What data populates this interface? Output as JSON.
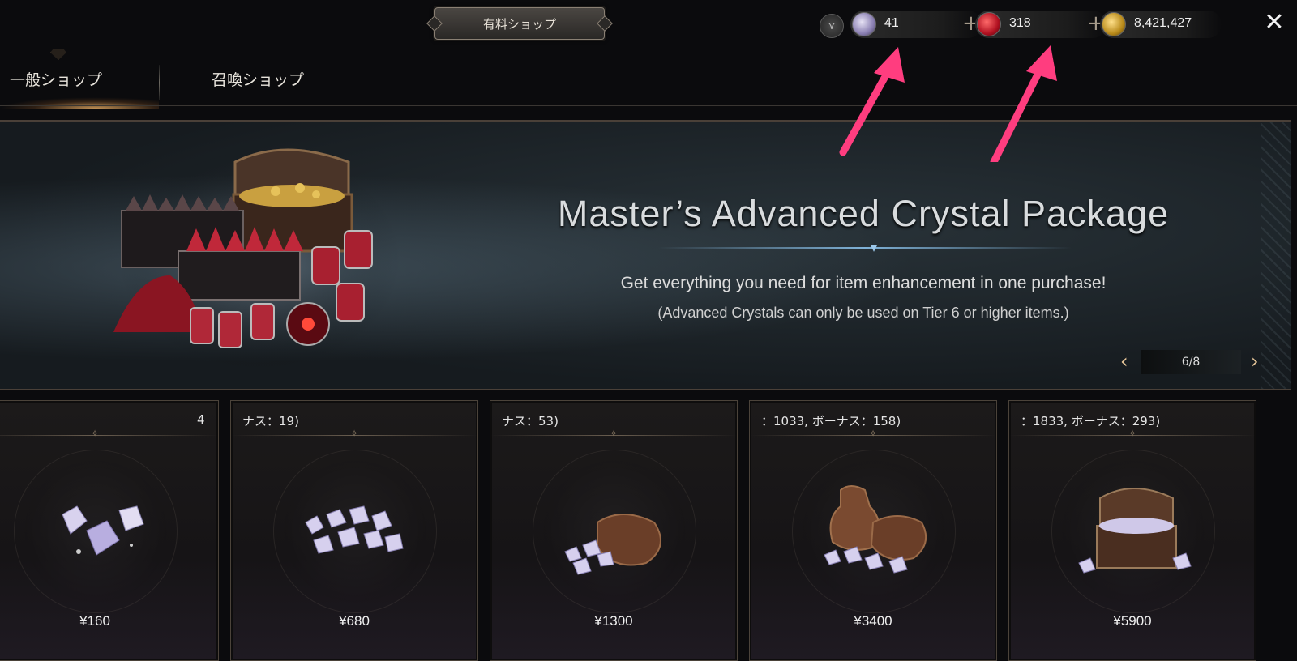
{
  "header": {
    "shop_title": "有料ショップ",
    "dropdown_symbol": "⋎",
    "close_symbol": "✕",
    "currencies": [
      {
        "name": "diamond-crystal",
        "value": "41",
        "has_plus": true
      },
      {
        "name": "red-crystal",
        "value": "318",
        "has_plus": true
      },
      {
        "name": "gold",
        "value": "8,421,427",
        "has_plus": false
      }
    ],
    "plus_symbol": "+"
  },
  "tabs": [
    {
      "label": "一般ショップ",
      "active": true
    },
    {
      "label": "召喚ショップ",
      "active": false
    }
  ],
  "banner": {
    "title": "Master’s Advanced Crystal Package",
    "description": "Get everything you need for item enhancement in one purchase!",
    "note": "(Advanced Crystals can only be used on Tier 6 or higher items.)",
    "page": "6/8",
    "prev_symbol": "‹",
    "next_symbol": "›"
  },
  "products": [
    {
      "name": "4",
      "price": "¥160",
      "icon": "few-crystals-icon"
    },
    {
      "name": "ナス：19)",
      "price": "¥680",
      "icon": "crystal-pile-icon"
    },
    {
      "name": "ナス：53)",
      "price": "¥1300",
      "icon": "crystal-bag-icon"
    },
    {
      "name": "：1033, ボーナス：158)",
      "price": "¥3400",
      "icon": "crystal-bags-icon"
    },
    {
      "name": "：1833, ボーナス：293)",
      "price": "¥5900",
      "icon": "crystal-chest-icon"
    }
  ],
  "colors": {
    "background": "#0b0b0d",
    "accent_gold": "#e8c79a",
    "annotation_arrow": "#ff3d7f",
    "banner_line": "#7fb2d8"
  }
}
